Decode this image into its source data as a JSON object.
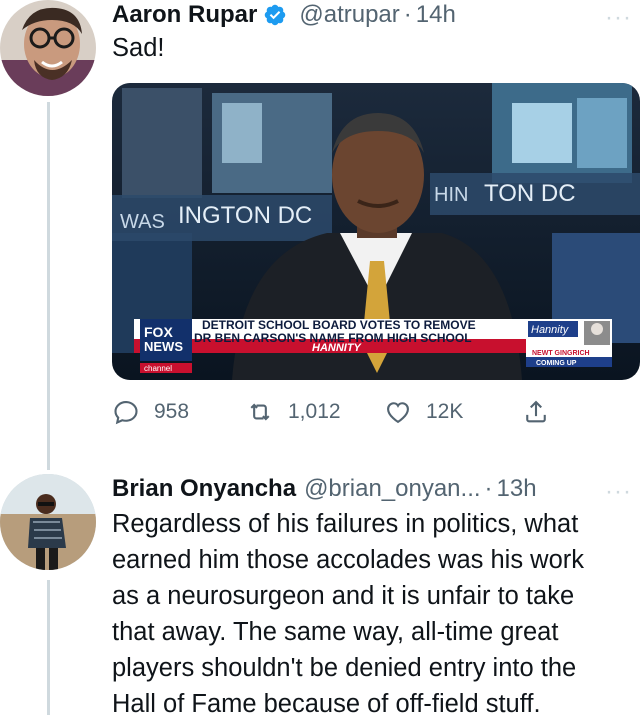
{
  "tweets": [
    {
      "author_name": "Aaron Rupar",
      "handle": "@atrupar",
      "separator": "·",
      "time": "14h",
      "more": "···",
      "text": "Sad!",
      "verified": true,
      "media": {
        "background_text_left": "INGTON DC",
        "background_text_left_prefix": "WAS",
        "background_text_right": "TON DC",
        "background_text_right_prefix": "HIN",
        "chyron_line1": "DETROIT SCHOOL BOARD VOTES TO REMOVE",
        "chyron_line2": "DR BEN CARSON'S NAME FROM HIGH SCHOOL",
        "chyron_show": "HANNITY",
        "logo_top": "FOX",
        "logo_bottom": "NEWS",
        "logo_channel": "channel",
        "promo_show": "Hannity",
        "promo_line1": "NEWT GINGRICH",
        "promo_line2": "COMING UP"
      },
      "actions": {
        "replies": "958",
        "retweets": "1,012",
        "likes": "12K"
      }
    },
    {
      "author_name": "Brian Onyancha",
      "handle": "@brian_onyan...",
      "separator": "·",
      "time": "13h",
      "more": "···",
      "text_lines": [
        "Regardless of his failures in politics, what",
        "earned him those accolades was his work",
        "as a neurosurgeon and it is unfair to take",
        "that away. The same way, all-time great",
        "players shouldn't be denied entry into the",
        "Hall of Fame because of off-field stuff."
      ]
    }
  ],
  "colors": {
    "verified_blue": "#1d9bf0",
    "secondary_text": "#536471",
    "thread_line": "#cfd9de",
    "chyron_red": "#c8102e",
    "fox_blue": "#12306b"
  },
  "icons": [
    "verified-badge-icon",
    "reply-icon",
    "retweet-icon",
    "like-icon",
    "share-icon",
    "more-icon"
  ]
}
